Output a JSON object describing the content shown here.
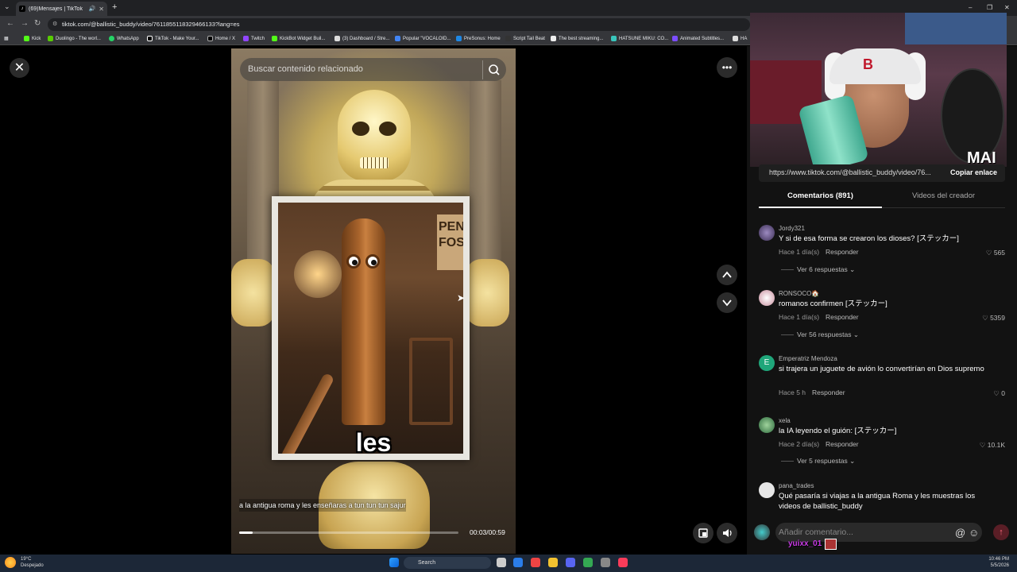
{
  "browser": {
    "tab_title": "(69)Mensajes | TikTok",
    "tab_favicon": "♪",
    "url": "tiktok.com/@ballistic_buddy/video/7611855118329466133?lang=es",
    "bookmarks": [
      "Kick",
      "Duolingo - The worl...",
      "WhatsApp",
      "TikTok - Make Your...",
      "Home / X",
      "Twitch",
      "KickBot Widget Buil...",
      "(3) Dashboard / Stre...",
      "Popular \"VOCALOID...",
      "PreSonus: Home",
      "Script Tail Beat",
      "The best streaming...",
      "HATSUNE MIKU: CO...",
      "Animated Subtitles...",
      "HA"
    ]
  },
  "video": {
    "search_placeholder": "Buscar contenido relacionado",
    "caption_word": "les",
    "sign_text": "PEN FOS",
    "description": "a la antigua roma y les enseñaras a tun tun tun sajur",
    "time": "00:03/00:59",
    "progress": 0.06
  },
  "stream_overlay": {
    "watermark": "MAI",
    "cap_logo": "B",
    "chat_user": "yuixx_01"
  },
  "panel": {
    "link_url": "https://www.tiktok.com/@ballistic_buddy/video/76...",
    "copy_label": "Copiar enlace",
    "tab_comments": "Comentarios (891)",
    "tab_videos": "Videos del creador",
    "comments": [
      {
        "user": "Jordy321",
        "text": "Y si de esa forma se crearon los dioses? [ステッカー]",
        "time": "Hace 1 día(s)",
        "reply": "Responder",
        "likes": "565",
        "replies": "Ver 6 respuestas",
        "avatar_color": "#6a5a8a"
      },
      {
        "user": "RONSOCO🏠",
        "text": "romanos confirmen [ステッカー]",
        "time": "Hace 1 día(s)",
        "reply": "Responder",
        "likes": "5359",
        "replies": "Ver 56 respuestas",
        "avatar_color": "#c9c2c5"
      },
      {
        "user": "Emperatriz Mendoza",
        "avatar_letter": "E",
        "text": "si trajera un juguete de avión lo convertirían en Dios supremo",
        "time": "Hace 5 h",
        "reply": "Responder",
        "likes": "0",
        "replies": "",
        "avatar_color": "#1fa67a"
      },
      {
        "user": "xela",
        "text": "la IA leyendo el guión: [ステッカー]",
        "time": "Hace 2 día(s)",
        "reply": "Responder",
        "likes": "10.1K",
        "replies": "Ver 5 respuestas",
        "avatar_color": "#3e8e5a"
      },
      {
        "user": "pana_trades",
        "text": "Qué pasaría si viajas a la antigua Roma y les muestras los videos de ballistic_buddy",
        "time": "",
        "reply": "",
        "likes": "",
        "replies": "",
        "avatar_color": "#e6e6e6"
      }
    ],
    "input_placeholder": "Añadir comentario..."
  },
  "taskbar": {
    "temp": "19°C",
    "weather": "Despejado",
    "search": "Search",
    "time": "10:46 PM",
    "date": "5/5/2026"
  }
}
